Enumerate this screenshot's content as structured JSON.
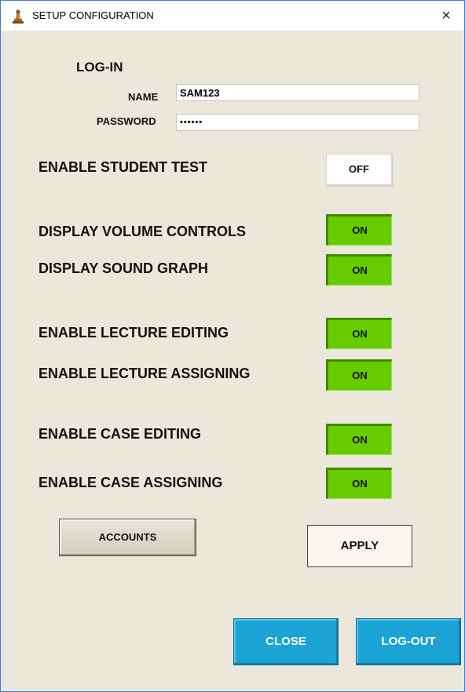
{
  "window": {
    "title": "SETUP CONFIGURATION",
    "close_glyph": "×",
    "icon": "chess-pawn-icon"
  },
  "login": {
    "title": "LOG-IN",
    "name_label": "NAME",
    "name_value": "SAM123",
    "password_label": "PASSWORD",
    "password_value": "••••••"
  },
  "options": {
    "student_test": {
      "label": "ENABLE STUDENT TEST",
      "state": "OFF"
    },
    "volume_controls": {
      "label": "DISPLAY VOLUME CONTROLS",
      "state": "ON"
    },
    "sound_graph": {
      "label": "DISPLAY SOUND GRAPH",
      "state": "ON"
    },
    "lecture_editing": {
      "label": "ENABLE LECTURE EDITING",
      "state": "ON"
    },
    "lecture_assigning": {
      "label": "ENABLE LECTURE ASSIGNING",
      "state": "ON"
    },
    "case_editing": {
      "label": "ENABLE CASE EDITING",
      "state": "ON"
    },
    "case_assigning": {
      "label": "ENABLE CASE ASSIGNING",
      "state": "ON"
    }
  },
  "buttons": {
    "accounts": "ACCOUNTS",
    "apply": "APPLY",
    "close": "CLOSE",
    "logout": "LOG-OUT"
  },
  "colors": {
    "on": "#66cc00",
    "off": "#ffffff",
    "blue_button": "#1ba3d6",
    "background": "#ebe7db"
  }
}
